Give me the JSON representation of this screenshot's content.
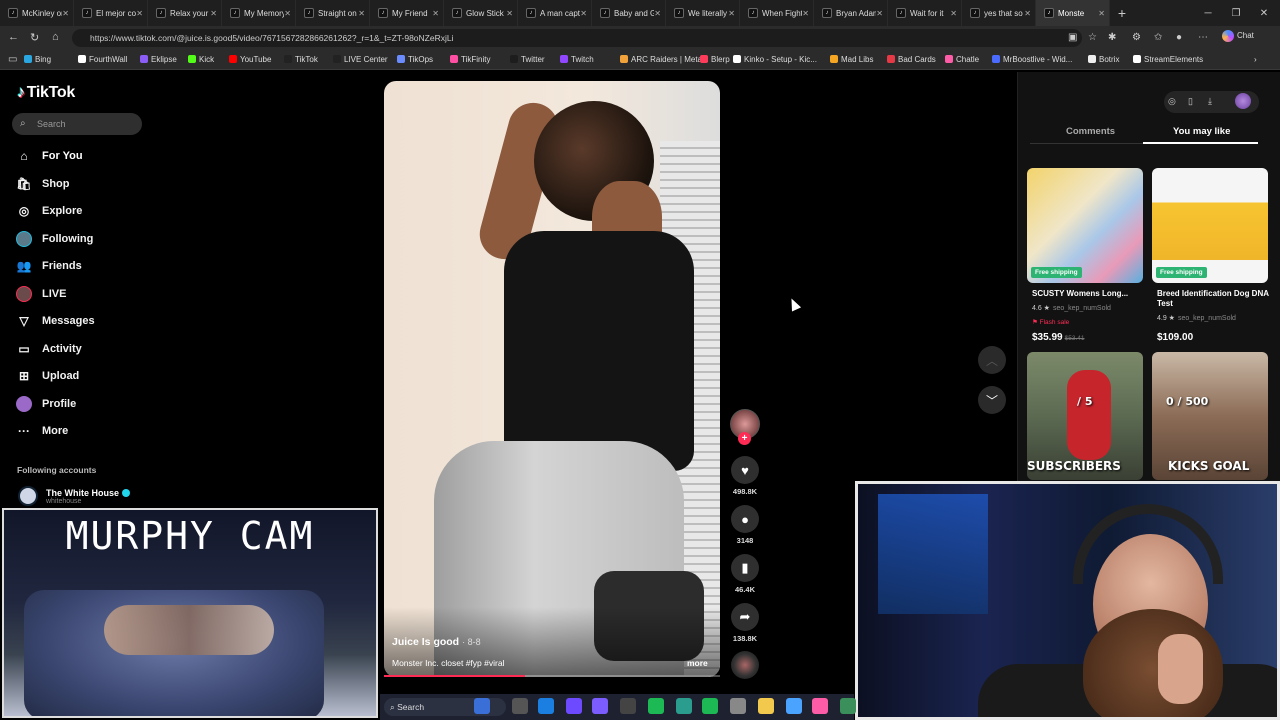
{
  "browser": {
    "tabs": [
      {
        "title": "McKinley on",
        "active": false
      },
      {
        "title": "El mejor co",
        "active": false
      },
      {
        "title": "Relax your",
        "active": false
      },
      {
        "title": "My Memory",
        "active": false
      },
      {
        "title": "Straight on",
        "active": false
      },
      {
        "title": "My Friend",
        "active": false
      },
      {
        "title": "Glow Stick",
        "active": false
      },
      {
        "title": "A man capt",
        "active": false
      },
      {
        "title": "Baby and G",
        "active": false
      },
      {
        "title": "We literally",
        "active": false
      },
      {
        "title": "When Fight",
        "active": false
      },
      {
        "title": "Bryan Adam",
        "active": false
      },
      {
        "title": "Wait for it",
        "active": false
      },
      {
        "title": "yes that so",
        "active": false
      },
      {
        "title": "Monste",
        "active": true
      }
    ],
    "url": "https://www.tiktok.com/@juice.is.good5/video/7671567282866261262?_r=1&_t=ZT-98oNZeRxjLi",
    "chat_label": "Chat",
    "bookmarks": [
      {
        "label": "Bing",
        "color": "#2aa6e0"
      },
      {
        "label": "FourthWall",
        "color": "#ffffff"
      },
      {
        "label": "Eklipse",
        "color": "#8b5cf6"
      },
      {
        "label": "Kick",
        "color": "#53fc18"
      },
      {
        "label": "YouTube",
        "color": "#ff0000"
      },
      {
        "label": "TikTok",
        "color": "#222222"
      },
      {
        "label": "LIVE Center",
        "color": "#222222"
      },
      {
        "label": "TikOps",
        "color": "#6b8cff"
      },
      {
        "label": "TikFinity",
        "color": "#ff4fa3"
      },
      {
        "label": "Twitter",
        "color": "#1d1d1d"
      },
      {
        "label": "Twitch",
        "color": "#9146ff"
      },
      {
        "label": "ARC Raiders | Meta...",
        "color": "#f2a23a"
      },
      {
        "label": "Blerp",
        "color": "#ff3b5c"
      },
      {
        "label": "Kinko - Setup - Kic...",
        "color": "#ffffff"
      },
      {
        "label": "Mad Libs",
        "color": "#f5a623"
      },
      {
        "label": "Bad Cards",
        "color": "#e63946"
      },
      {
        "label": "Chatle",
        "color": "#ff5ca8"
      },
      {
        "label": "MrBoostlive - Wid...",
        "color": "#4b6bff"
      },
      {
        "label": "Botrix",
        "color": "#eeeeee"
      },
      {
        "label": "StreamElements",
        "color": "#ffffff"
      }
    ]
  },
  "tiktok": {
    "logo": "TikTok",
    "search_placeholder": "Search",
    "nav": [
      {
        "label": "For You",
        "icon": "home-icon"
      },
      {
        "label": "Shop",
        "icon": "shop-icon"
      },
      {
        "label": "Explore",
        "icon": "compass-icon"
      },
      {
        "label": "Following",
        "icon": "following-avatar-icon"
      },
      {
        "label": "Friends",
        "icon": "friends-icon"
      },
      {
        "label": "LIVE",
        "icon": "live-icon"
      },
      {
        "label": "Messages",
        "icon": "messages-icon"
      },
      {
        "label": "Activity",
        "icon": "activity-icon"
      },
      {
        "label": "Upload",
        "icon": "upload-icon"
      },
      {
        "label": "Profile",
        "icon": "profile-icon"
      },
      {
        "label": "More",
        "icon": "more-icon"
      }
    ],
    "following_heading": "Following accounts",
    "following_account": {
      "name": "The White House",
      "handle": "whitehouse"
    },
    "video": {
      "author": "Juice Is good",
      "date": "· 8-8",
      "caption": "Monster Inc. closet #fyp #viral",
      "more_label": "more",
      "progress": 0.42
    },
    "actions": {
      "likes": "498.8K",
      "comments": "3148",
      "saves": "46.4K",
      "shares": "138.8K"
    },
    "right_panel": {
      "tab_comments": "Comments",
      "tab_you_may_like": "You may like",
      "products": [
        {
          "badge": "Free shipping",
          "title": "SCUSTY Womens Long...",
          "rating": "4.6 ★",
          "seller": "seo_kep_numSold",
          "flash": "Flash sale",
          "price": "$35.99",
          "old_price": "$53.41"
        },
        {
          "badge": "Free shipping",
          "title": "Breed Identification Dog DNA Test",
          "rating": "4.9 ★",
          "seller": "seo_kep_numSold",
          "price": "$109.00"
        }
      ],
      "thumbs": [
        {
          "overlay_top": "/ 5",
          "overlay_bottom": "SUBSCRIBERS"
        },
        {
          "overlay_top": "0 / 500",
          "overlay_bottom": "KICKS GOAL"
        }
      ]
    }
  },
  "overlays": {
    "murphy_cam_title": "MURPHY CAM"
  },
  "taskbar": {
    "search_label": "Search"
  }
}
